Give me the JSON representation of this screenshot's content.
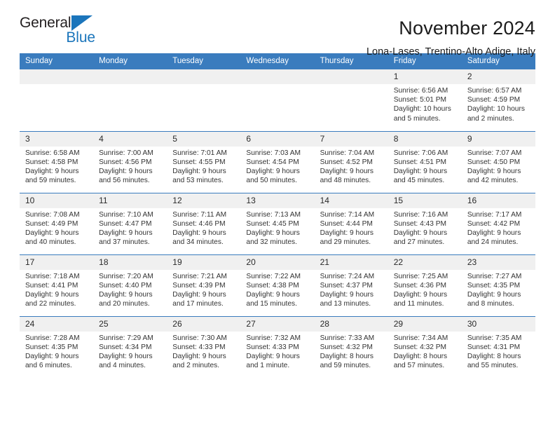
{
  "brand": {
    "name_top": "General",
    "name_bottom": "Blue",
    "accent_color": "#1b75bb"
  },
  "header": {
    "title": "November 2024",
    "subtitle": "Lona-Lases, Trentino-Alto Adige, Italy"
  },
  "calendar": {
    "header_color": "#3a7cbe",
    "weekdays": [
      "Sunday",
      "Monday",
      "Tuesday",
      "Wednesday",
      "Thursday",
      "Friday",
      "Saturday"
    ],
    "weeks": [
      [
        {
          "day": "",
          "empty": true
        },
        {
          "day": "",
          "empty": true
        },
        {
          "day": "",
          "empty": true
        },
        {
          "day": "",
          "empty": true
        },
        {
          "day": "",
          "empty": true
        },
        {
          "day": "1",
          "sunrise": "Sunrise: 6:56 AM",
          "sunset": "Sunset: 5:01 PM",
          "daylight1": "Daylight: 10 hours",
          "daylight2": "and 5 minutes."
        },
        {
          "day": "2",
          "sunrise": "Sunrise: 6:57 AM",
          "sunset": "Sunset: 4:59 PM",
          "daylight1": "Daylight: 10 hours",
          "daylight2": "and 2 minutes."
        }
      ],
      [
        {
          "day": "3",
          "sunrise": "Sunrise: 6:58 AM",
          "sunset": "Sunset: 4:58 PM",
          "daylight1": "Daylight: 9 hours",
          "daylight2": "and 59 minutes."
        },
        {
          "day": "4",
          "sunrise": "Sunrise: 7:00 AM",
          "sunset": "Sunset: 4:56 PM",
          "daylight1": "Daylight: 9 hours",
          "daylight2": "and 56 minutes."
        },
        {
          "day": "5",
          "sunrise": "Sunrise: 7:01 AM",
          "sunset": "Sunset: 4:55 PM",
          "daylight1": "Daylight: 9 hours",
          "daylight2": "and 53 minutes."
        },
        {
          "day": "6",
          "sunrise": "Sunrise: 7:03 AM",
          "sunset": "Sunset: 4:54 PM",
          "daylight1": "Daylight: 9 hours",
          "daylight2": "and 50 minutes."
        },
        {
          "day": "7",
          "sunrise": "Sunrise: 7:04 AM",
          "sunset": "Sunset: 4:52 PM",
          "daylight1": "Daylight: 9 hours",
          "daylight2": "and 48 minutes."
        },
        {
          "day": "8",
          "sunrise": "Sunrise: 7:06 AM",
          "sunset": "Sunset: 4:51 PM",
          "daylight1": "Daylight: 9 hours",
          "daylight2": "and 45 minutes."
        },
        {
          "day": "9",
          "sunrise": "Sunrise: 7:07 AM",
          "sunset": "Sunset: 4:50 PM",
          "daylight1": "Daylight: 9 hours",
          "daylight2": "and 42 minutes."
        }
      ],
      [
        {
          "day": "10",
          "sunrise": "Sunrise: 7:08 AM",
          "sunset": "Sunset: 4:49 PM",
          "daylight1": "Daylight: 9 hours",
          "daylight2": "and 40 minutes."
        },
        {
          "day": "11",
          "sunrise": "Sunrise: 7:10 AM",
          "sunset": "Sunset: 4:47 PM",
          "daylight1": "Daylight: 9 hours",
          "daylight2": "and 37 minutes."
        },
        {
          "day": "12",
          "sunrise": "Sunrise: 7:11 AM",
          "sunset": "Sunset: 4:46 PM",
          "daylight1": "Daylight: 9 hours",
          "daylight2": "and 34 minutes."
        },
        {
          "day": "13",
          "sunrise": "Sunrise: 7:13 AM",
          "sunset": "Sunset: 4:45 PM",
          "daylight1": "Daylight: 9 hours",
          "daylight2": "and 32 minutes."
        },
        {
          "day": "14",
          "sunrise": "Sunrise: 7:14 AM",
          "sunset": "Sunset: 4:44 PM",
          "daylight1": "Daylight: 9 hours",
          "daylight2": "and 29 minutes."
        },
        {
          "day": "15",
          "sunrise": "Sunrise: 7:16 AM",
          "sunset": "Sunset: 4:43 PM",
          "daylight1": "Daylight: 9 hours",
          "daylight2": "and 27 minutes."
        },
        {
          "day": "16",
          "sunrise": "Sunrise: 7:17 AM",
          "sunset": "Sunset: 4:42 PM",
          "daylight1": "Daylight: 9 hours",
          "daylight2": "and 24 minutes."
        }
      ],
      [
        {
          "day": "17",
          "sunrise": "Sunrise: 7:18 AM",
          "sunset": "Sunset: 4:41 PM",
          "daylight1": "Daylight: 9 hours",
          "daylight2": "and 22 minutes."
        },
        {
          "day": "18",
          "sunrise": "Sunrise: 7:20 AM",
          "sunset": "Sunset: 4:40 PM",
          "daylight1": "Daylight: 9 hours",
          "daylight2": "and 20 minutes."
        },
        {
          "day": "19",
          "sunrise": "Sunrise: 7:21 AM",
          "sunset": "Sunset: 4:39 PM",
          "daylight1": "Daylight: 9 hours",
          "daylight2": "and 17 minutes."
        },
        {
          "day": "20",
          "sunrise": "Sunrise: 7:22 AM",
          "sunset": "Sunset: 4:38 PM",
          "daylight1": "Daylight: 9 hours",
          "daylight2": "and 15 minutes."
        },
        {
          "day": "21",
          "sunrise": "Sunrise: 7:24 AM",
          "sunset": "Sunset: 4:37 PM",
          "daylight1": "Daylight: 9 hours",
          "daylight2": "and 13 minutes."
        },
        {
          "day": "22",
          "sunrise": "Sunrise: 7:25 AM",
          "sunset": "Sunset: 4:36 PM",
          "daylight1": "Daylight: 9 hours",
          "daylight2": "and 11 minutes."
        },
        {
          "day": "23",
          "sunrise": "Sunrise: 7:27 AM",
          "sunset": "Sunset: 4:35 PM",
          "daylight1": "Daylight: 9 hours",
          "daylight2": "and 8 minutes."
        }
      ],
      [
        {
          "day": "24",
          "sunrise": "Sunrise: 7:28 AM",
          "sunset": "Sunset: 4:35 PM",
          "daylight1": "Daylight: 9 hours",
          "daylight2": "and 6 minutes."
        },
        {
          "day": "25",
          "sunrise": "Sunrise: 7:29 AM",
          "sunset": "Sunset: 4:34 PM",
          "daylight1": "Daylight: 9 hours",
          "daylight2": "and 4 minutes."
        },
        {
          "day": "26",
          "sunrise": "Sunrise: 7:30 AM",
          "sunset": "Sunset: 4:33 PM",
          "daylight1": "Daylight: 9 hours",
          "daylight2": "and 2 minutes."
        },
        {
          "day": "27",
          "sunrise": "Sunrise: 7:32 AM",
          "sunset": "Sunset: 4:33 PM",
          "daylight1": "Daylight: 9 hours",
          "daylight2": "and 1 minute."
        },
        {
          "day": "28",
          "sunrise": "Sunrise: 7:33 AM",
          "sunset": "Sunset: 4:32 PM",
          "daylight1": "Daylight: 8 hours",
          "daylight2": "and 59 minutes."
        },
        {
          "day": "29",
          "sunrise": "Sunrise: 7:34 AM",
          "sunset": "Sunset: 4:32 PM",
          "daylight1": "Daylight: 8 hours",
          "daylight2": "and 57 minutes."
        },
        {
          "day": "30",
          "sunrise": "Sunrise: 7:35 AM",
          "sunset": "Sunset: 4:31 PM",
          "daylight1": "Daylight: 8 hours",
          "daylight2": "and 55 minutes."
        }
      ]
    ]
  }
}
